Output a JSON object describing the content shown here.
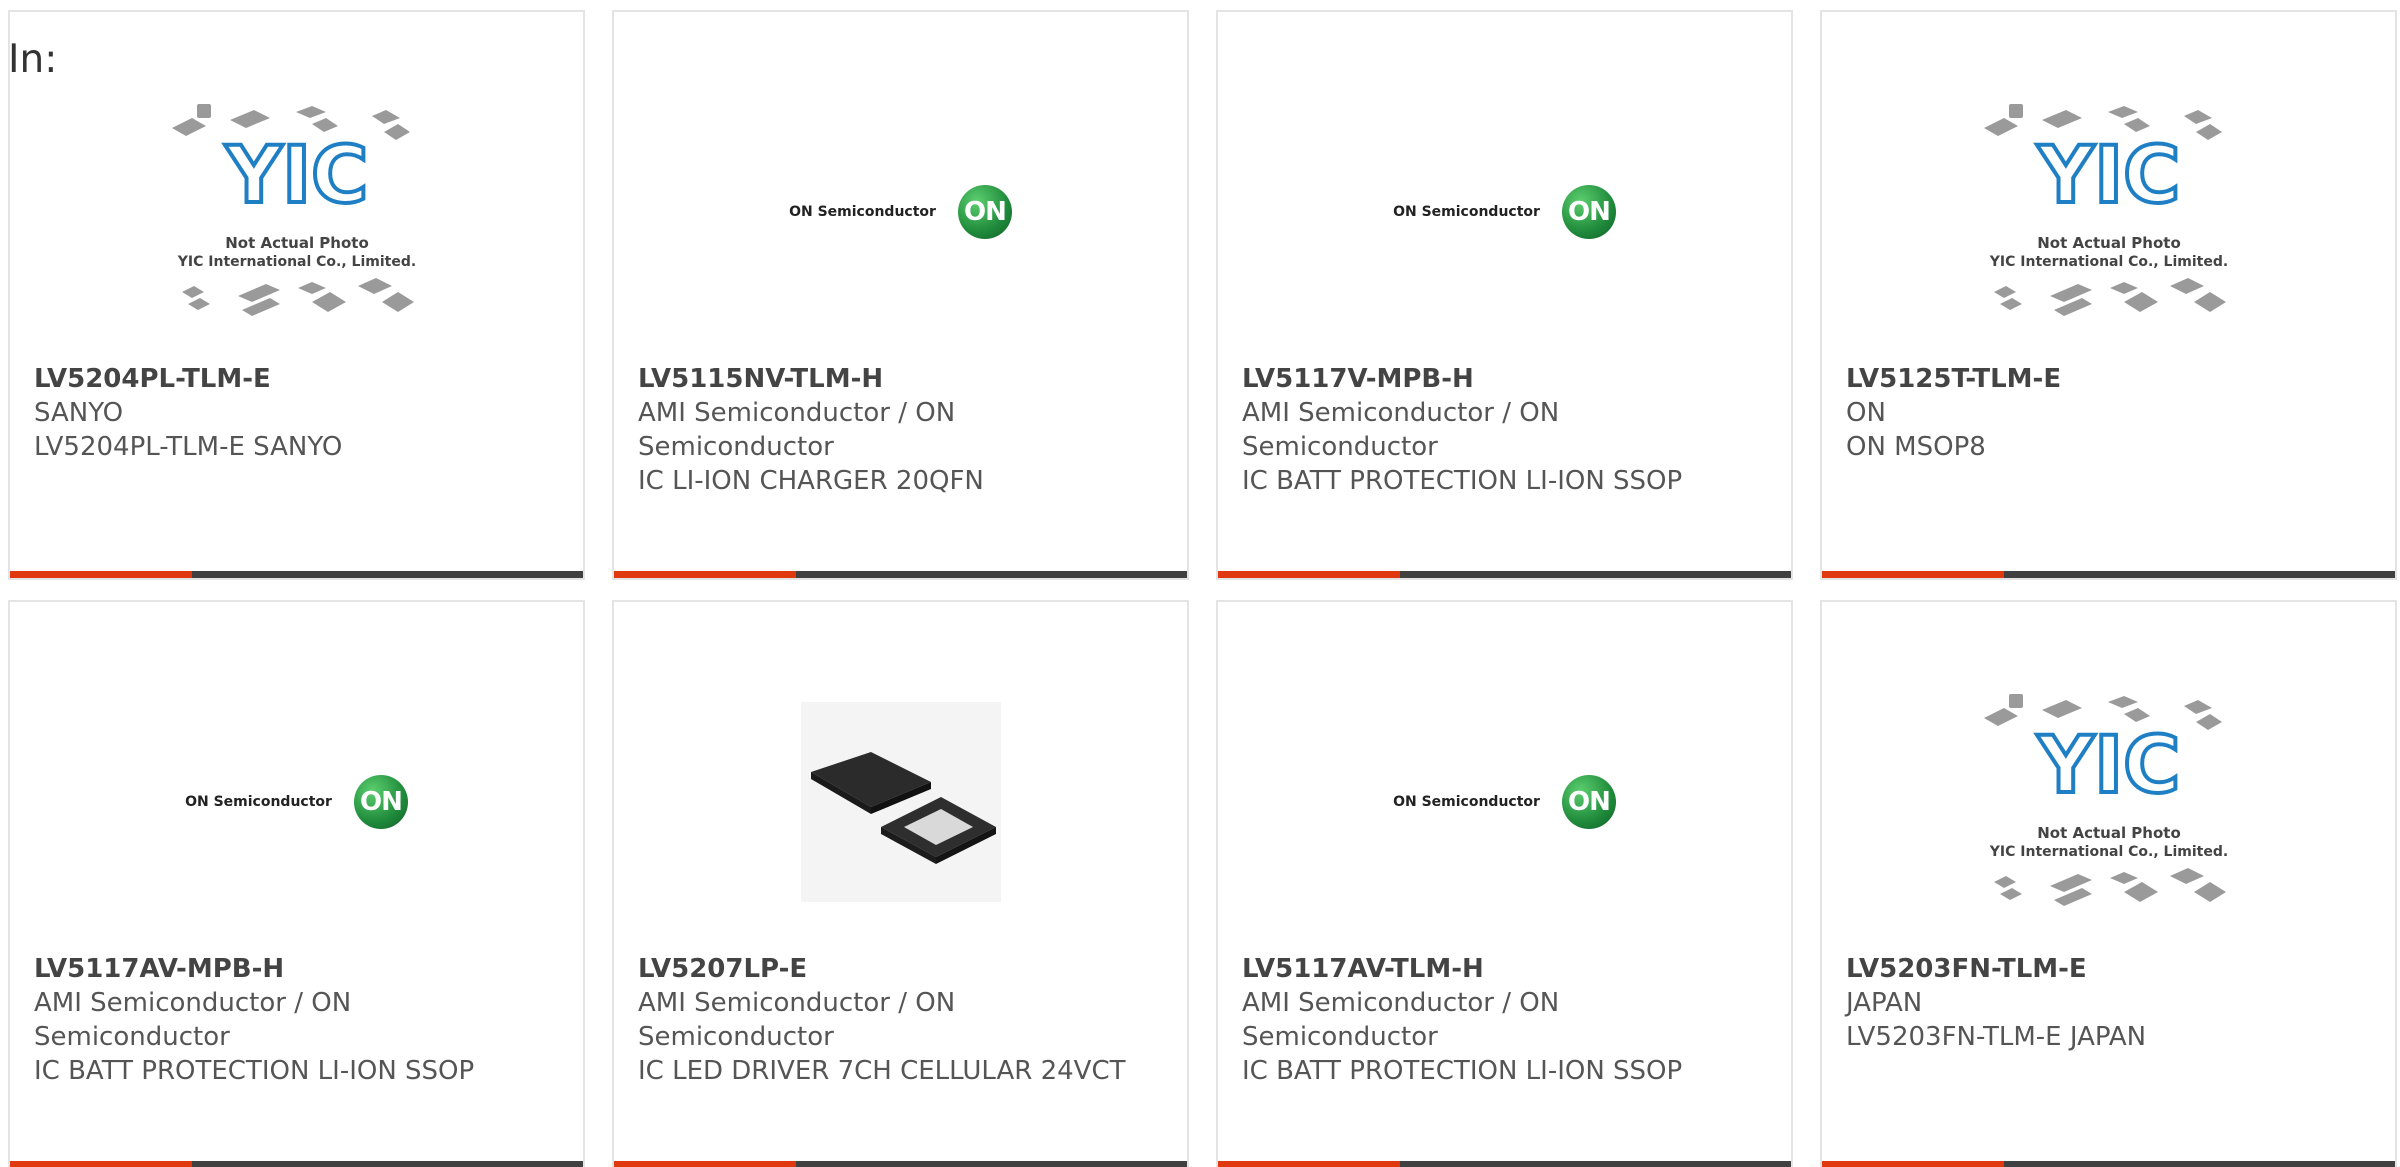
{
  "heading": "In:",
  "placeholder": {
    "line1": "Not Actual Photo",
    "line2": "YIC International Co., Limited.",
    "brand_letters": "YIC"
  },
  "on_logo": {
    "company_text": "ON Semiconductor",
    "badge_text": "ON"
  },
  "colors": {
    "accent": "#e0380f",
    "bar_dark": "#404040",
    "yic_blue": "#1f7fc4",
    "on_green": "#1f8a3b"
  },
  "products": [
    {
      "part": "LV5204PL-TLM-E",
      "manufacturer": "SANYO",
      "description": "LV5204PL-TLM-E SANYO",
      "image": "yic-placeholder"
    },
    {
      "part": "LV5115NV-TLM-H",
      "manufacturer": "AMI Semiconductor / ON Semiconductor",
      "description": "IC LI-ION CHARGER 20QFN",
      "image": "on-semiconductor-logo"
    },
    {
      "part": "LV5117V-MPB-H",
      "manufacturer": "AMI Semiconductor / ON Semiconductor",
      "description": "IC BATT PROTECTION LI-ION SSOP",
      "image": "on-semiconductor-logo"
    },
    {
      "part": "LV5125T-TLM-E",
      "manufacturer": "ON",
      "description": "ON MSOP8",
      "image": "yic-placeholder"
    },
    {
      "part": "LV5117AV-MPB-H",
      "manufacturer": "AMI Semiconductor / ON Semiconductor",
      "description": "IC BATT PROTECTION LI-ION SSOP",
      "image": "on-semiconductor-logo"
    },
    {
      "part": "LV5207LP-E",
      "manufacturer": "AMI Semiconductor / ON Semiconductor",
      "description": "IC LED DRIVER 7CH CELLULAR 24VCT",
      "image": "qfn-chip-photo"
    },
    {
      "part": "LV5117AV-TLM-H",
      "manufacturer": "AMI Semiconductor / ON Semiconductor",
      "description": "IC BATT PROTECTION LI-ION SSOP",
      "image": "on-semiconductor-logo"
    },
    {
      "part": "LV5203FN-TLM-E",
      "manufacturer": "JAPAN",
      "description": "LV5203FN-TLM-E JAPAN",
      "image": "yic-placeholder"
    }
  ]
}
